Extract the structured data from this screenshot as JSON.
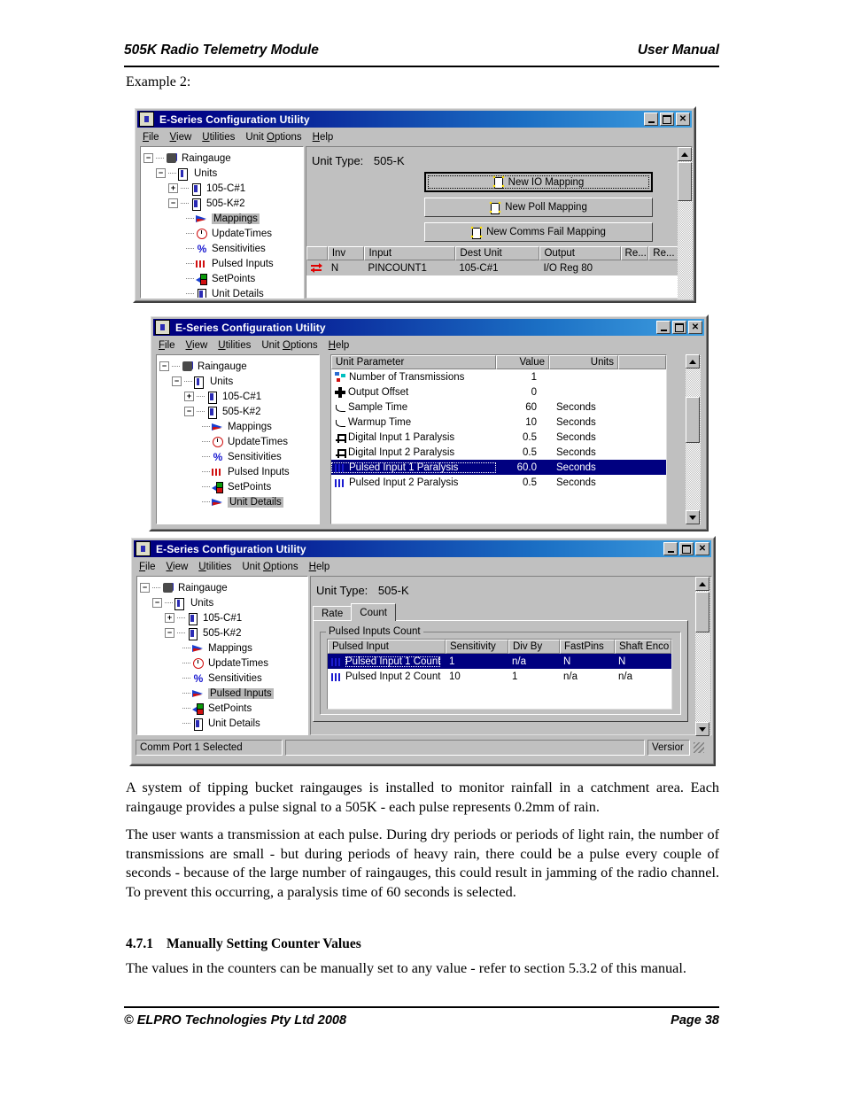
{
  "header": {
    "left": "505K Radio Telemetry Module",
    "right": "User Manual"
  },
  "footer": {
    "left": "© ELPRO Technologies Pty Ltd 2008",
    "right": "Page 38"
  },
  "example_label": "Example 2:",
  "window_title": "E-Series Configuration Utility",
  "menu": [
    "File",
    "View",
    "Utilities",
    "Unit Options",
    "Help"
  ],
  "title_buttons": {
    "minimize": "_",
    "maximize": "□",
    "close": "X"
  },
  "tree": {
    "root": "Raingauge",
    "units_label": "Units",
    "unit1": "105-C#1",
    "unit2": "505-K#2",
    "children": [
      "Mappings",
      "UpdateTimes",
      "Sensitivities",
      "Pulsed Inputs",
      "SetPoints",
      "Unit Details"
    ]
  },
  "window1": {
    "unit_type_label": "Unit Type:",
    "unit_type_value": "505-K",
    "selected_tree_item": "Mappings",
    "buttons": [
      {
        "label": "New IO Mapping",
        "icon": "new-document-icon",
        "default": true
      },
      {
        "label": "New Poll Mapping",
        "icon": "new-document-icon",
        "default": false
      },
      {
        "label": "New Comms Fail Mapping",
        "icon": "new-document-icon",
        "default": false
      }
    ],
    "grid": {
      "columns": [
        "",
        "Inv",
        "Input",
        "Dest Unit",
        "Output",
        "Re...",
        "Re..."
      ],
      "rows": [
        {
          "icon": "mapping-arrows-icon",
          "inv": "N",
          "input": "PINCOUNT1",
          "dest_unit": "105-C#1",
          "output": "I/O Reg 80",
          "re1": "",
          "re2": ""
        }
      ]
    }
  },
  "window2": {
    "selected_tree_item": "Unit Details",
    "grid": {
      "columns": [
        "Unit Parameter",
        "Value",
        "Units",
        ""
      ],
      "rows": [
        {
          "icon": "network-icon",
          "parameter": "Number of Transmissions",
          "value": "1",
          "units": "",
          "selected": false
        },
        {
          "icon": "offset-icon",
          "parameter": "Output Offset",
          "value": "0",
          "units": "",
          "selected": false
        },
        {
          "icon": "wave-icon",
          "parameter": "Sample Time",
          "value": "60",
          "units": "Seconds",
          "selected": false
        },
        {
          "icon": "wave-icon",
          "parameter": "Warmup Time",
          "value": "10",
          "units": "Seconds",
          "selected": false
        },
        {
          "icon": "square-pulse-icon",
          "parameter": "Digital Input 1 Paralysis",
          "value": "0.5",
          "units": "Seconds",
          "selected": false
        },
        {
          "icon": "square-pulse-icon",
          "parameter": "Digital Input 2 Paralysis",
          "value": "0.5",
          "units": "Seconds",
          "selected": false
        },
        {
          "icon": "pulse-train-icon",
          "parameter": "Pulsed Input 1 Paralysis",
          "value": "60.0",
          "units": "Seconds",
          "selected": true
        },
        {
          "icon": "pulse-train-icon",
          "parameter": "Pulsed Input 2 Paralysis",
          "value": "0.5",
          "units": "Seconds",
          "selected": false
        }
      ]
    }
  },
  "window3": {
    "selected_tree_item": "Pulsed Inputs",
    "unit_type_label": "Unit Type:",
    "unit_type_value": "505-K",
    "tabs": [
      {
        "label": "Rate",
        "active": false
      },
      {
        "label": "Count",
        "active": true
      }
    ],
    "groupbox_title": "Pulsed Inputs Count",
    "grid": {
      "columns": [
        "Pulsed Input",
        "Sensitivity",
        "Div By",
        "FastPins",
        "Shaft Enco"
      ],
      "rows": [
        {
          "icon": "pulse-train-icon",
          "pulsed_input": "Pulsed Input 1 Count",
          "sensitivity": "1",
          "div_by": "n/a",
          "fastpins": "N",
          "shaft_encoder": "N",
          "selected": true
        },
        {
          "icon": "pulse-train-icon",
          "pulsed_input": "Pulsed Input 2 Count",
          "sensitivity": "10",
          "div_by": "1",
          "fastpins": "n/a",
          "shaft_encoder": "n/a",
          "selected": false
        }
      ]
    },
    "statusbar": {
      "comm": "Comm Port 1 Selected",
      "middle": "",
      "version": "Versior"
    }
  },
  "paragraphs": {
    "p1": "A system of tipping bucket raingauges is installed to monitor rainfall in a catchment area. Each raingauge provides a pulse signal to a 505K  -  each pulse represents 0.2mm of rain.",
    "p2": "The user wants a transmission at each pulse.  During dry periods or periods of light rain,  the number of transmissions are small  -  but during periods of heavy rain,  there could be a pulse every couple of seconds  -  because of the large number of raingauges,  this could result in jamming of the radio channel.  To prevent this occurring,  a paralysis time of 60 seconds is selected.",
    "p3": "The values in the counters can be manually set to any value  -  refer to section 5.3.2 of this manual."
  },
  "section": {
    "number": "4.7.1",
    "title": "Manually Setting Counter Values"
  }
}
